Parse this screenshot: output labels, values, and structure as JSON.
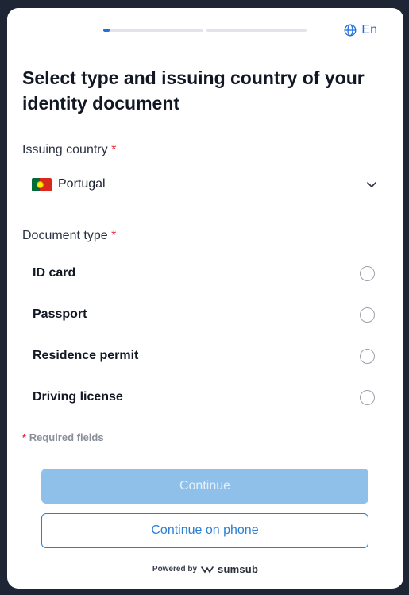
{
  "header": {
    "progress": {
      "steps": 2,
      "current_fill": 0.06
    },
    "language": {
      "label": "En",
      "icon": "globe-icon"
    }
  },
  "title": "Select type and issuing country of your identity document",
  "country_field": {
    "label": "Issuing country",
    "required_mark": "*",
    "value": "Portugal",
    "flag_icon": "portugal-flag-icon",
    "dropdown_icon": "chevron-down-icon"
  },
  "document_type": {
    "label": "Document type",
    "required_mark": "*",
    "options": [
      {
        "label": "ID card"
      },
      {
        "label": "Passport"
      },
      {
        "label": "Residence permit"
      },
      {
        "label": "Driving license"
      }
    ]
  },
  "required_note": {
    "mark": "*",
    "text": "Required fields"
  },
  "buttons": {
    "continue": "Continue",
    "continue_phone": "Continue on phone"
  },
  "footer": {
    "powered_by": "Powered by",
    "brand": "sumsub"
  },
  "colors": {
    "accent": "#1e6fe0",
    "required": "#e02e3b",
    "continue_disabled_bg": "#8fc0ea",
    "background": "#1e2535"
  }
}
